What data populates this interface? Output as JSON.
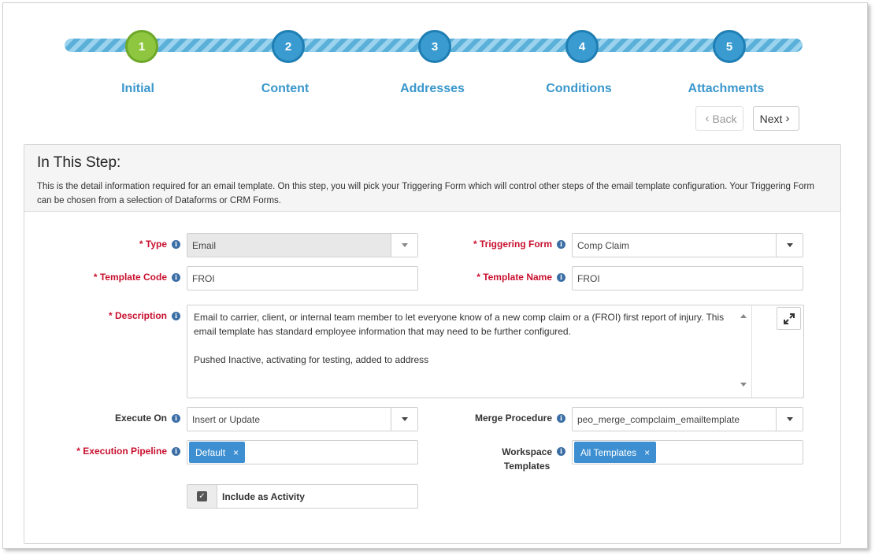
{
  "wizard": {
    "steps": [
      {
        "number": "1",
        "label": "Initial",
        "active": true
      },
      {
        "number": "2",
        "label": "Content",
        "active": false
      },
      {
        "number": "3",
        "label": "Addresses",
        "active": false
      },
      {
        "number": "4",
        "label": "Conditions",
        "active": false
      },
      {
        "number": "5",
        "label": "Attachments",
        "active": false
      }
    ],
    "back_label": "Back",
    "next_label": "Next"
  },
  "panel": {
    "title": "In This Step:",
    "description": "This is the detail information required for an email template. On this step, you will pick your Triggering Form which will control other steps of the email template configuration. Your Triggering Form can be chosen from a selection of Dataforms or CRM Forms."
  },
  "form": {
    "type": {
      "label": "* Type",
      "value": "Email"
    },
    "triggering_form": {
      "label": "* Triggering Form",
      "value": "Comp Claim"
    },
    "template_code": {
      "label": "* Template Code",
      "value": "FROI"
    },
    "template_name": {
      "label": "* Template Name",
      "value": "FROI"
    },
    "description": {
      "label": "* Description",
      "line1": "Email to carrier, client, or internal team member to let everyone know of a new comp claim or a (FROI) first report of injury. This email template has standard employee information that may need to be further configured.",
      "line2": "Pushed Inactive, activating for testing, added to address"
    },
    "execute_on": {
      "label": "Execute On",
      "value": "Insert or Update"
    },
    "merge_procedure": {
      "label": "Merge Procedure",
      "value": "peo_merge_compclaim_emailtemplate"
    },
    "execution_pipeline": {
      "label": "* Execution Pipeline",
      "tag": "Default"
    },
    "workspace_templates": {
      "label_line1": "Workspace",
      "label_line2": "Templates",
      "tag": "All Templates"
    },
    "include_activity": {
      "label": "Include as Activity",
      "checked": true
    }
  },
  "icons": {
    "info": "info-icon",
    "expand": "expand-icon",
    "back": "chevron-left-icon",
    "next": "chevron-right-icon",
    "remove": "close-icon",
    "dropdown": "caret-down-icon",
    "check": "checkmark-icon"
  },
  "colors": {
    "active_step": "#8ec63f",
    "step": "#3a9bd0",
    "step_label": "#3a97cc",
    "required": "#c8102e",
    "tag": "#3d8fd1"
  },
  "remove_glyph": "×",
  "info_glyph": "i"
}
